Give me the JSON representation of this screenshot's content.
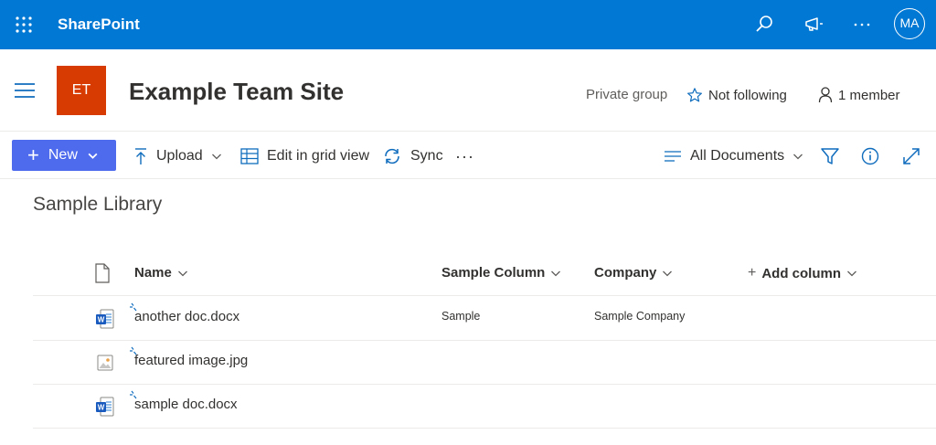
{
  "suite_bar": {
    "brand": "SharePoint",
    "avatar_initials": "MA",
    "background": "#0078d4"
  },
  "site": {
    "logo_initials": "ET",
    "logo_color": "#d83b01",
    "title": "Example Team Site",
    "privacy": "Private group",
    "follow_label": "Not following",
    "members_label": "1 member"
  },
  "command_bar": {
    "new_label": "New",
    "upload_label": "Upload",
    "grid_label": "Edit in grid view",
    "sync_label": "Sync",
    "more_label": "···",
    "view_label": "All Documents",
    "accent": "#4f6bed"
  },
  "library": {
    "title": "Sample Library",
    "columns": {
      "name": "Name",
      "sample": "Sample Column",
      "company": "Company",
      "add": "Add column"
    },
    "rows": [
      {
        "name": "another doc.docx",
        "type": "word-icon",
        "sample": "Sample",
        "company": "Sample Company"
      },
      {
        "name": "featured image.jpg",
        "type": "image-icon",
        "sample": "",
        "company": ""
      },
      {
        "name": "sample doc.docx",
        "type": "word-icon",
        "sample": "",
        "company": ""
      }
    ]
  }
}
